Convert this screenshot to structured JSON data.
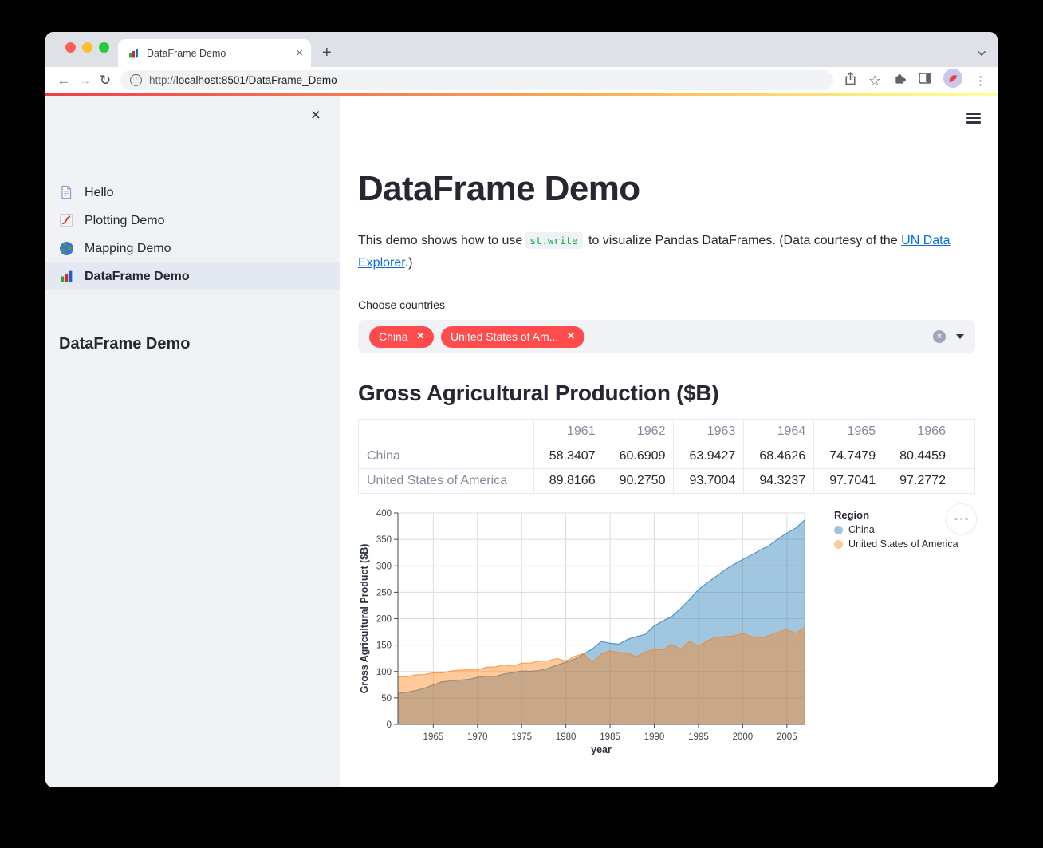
{
  "browser": {
    "tab_title": "DataFrame Demo",
    "url_scheme": "http://",
    "url_rest": "localhost:8501/DataFrame_Demo",
    "new_tab_label": "+"
  },
  "icons": {
    "back": "←",
    "forward": "→",
    "reload": "↻",
    "info": "i",
    "star": "☆",
    "dots_vertical": "⋮",
    "close": "×"
  },
  "sidebar": {
    "nav": [
      {
        "label": "Hello",
        "icon": "doc-icon",
        "selected": false
      },
      {
        "label": "Plotting Demo",
        "icon": "line-chart-icon",
        "selected": false
      },
      {
        "label": "Mapping Demo",
        "icon": "globe-icon",
        "selected": false
      },
      {
        "label": "DataFrame Demo",
        "icon": "bar-chart-icon",
        "selected": true
      }
    ],
    "title": "DataFrame Demo"
  },
  "main": {
    "title": "DataFrame Demo",
    "intro": {
      "before_code": "This demo shows how to use",
      "code": "st.write",
      "after_code": " to visualize Pandas DataFrames. (Data courtesy of the ",
      "link": "UN Data Explorer",
      "after_link": ".)"
    },
    "multiselect": {
      "label": "Choose countries",
      "selected": [
        "China",
        "United States of Am..."
      ]
    },
    "section_title": "Gross Agricultural Production ($B)",
    "table": {
      "headers": [
        "",
        "1961",
        "1962",
        "1963",
        "1964",
        "1965",
        "1966"
      ],
      "rows": [
        {
          "label": "China",
          "values": [
            "58.3407",
            "60.6909",
            "63.9427",
            "68.4626",
            "74.7479",
            "80.4459"
          ]
        },
        {
          "label": "United States of America",
          "values": [
            "89.8166",
            "90.2750",
            "93.7004",
            "94.3237",
            "97.7041",
            "97.2772"
          ]
        }
      ]
    }
  },
  "chart_data": {
    "type": "area",
    "title": "",
    "xlabel": "year",
    "ylabel": "Gross Agricultural Product ($B)",
    "legend_title": "Region",
    "legend_position": "right",
    "grid": true,
    "x_range": [
      1961,
      2007
    ],
    "ylim": [
      0,
      400
    ],
    "x_ticks": [
      1965,
      1970,
      1975,
      1980,
      1985,
      1990,
      1995,
      2000,
      2005
    ],
    "y_ticks": [
      0,
      50,
      100,
      150,
      200,
      250,
      300,
      350,
      400
    ],
    "x": [
      1961,
      1962,
      1963,
      1964,
      1965,
      1966,
      1967,
      1968,
      1969,
      1970,
      1971,
      1972,
      1973,
      1974,
      1975,
      1976,
      1977,
      1978,
      1979,
      1980,
      1981,
      1982,
      1983,
      1984,
      1985,
      1986,
      1987,
      1988,
      1989,
      1990,
      1991,
      1992,
      1993,
      1994,
      1995,
      1996,
      1997,
      1998,
      1999,
      2000,
      2001,
      2002,
      2003,
      2004,
      2005,
      2006,
      2007
    ],
    "series": [
      {
        "name": "China",
        "fill": "rgba(31,119,180,0.42)",
        "stroke": "rgba(31,119,180,0.75)",
        "legend_swatch": "#a1c6e0",
        "values": [
          58.34,
          60.69,
          63.94,
          68.46,
          74.75,
          80.45,
          82.3,
          83.8,
          85.2,
          88.9,
          91.5,
          90.8,
          95.3,
          98.0,
          101.2,
          100.6,
          101.9,
          106.3,
          112.0,
          117.9,
          123.6,
          132.9,
          142.8,
          157.0,
          153.5,
          151.8,
          161.0,
          166.2,
          170.5,
          186.4,
          195.9,
          204.6,
          219.7,
          236.5,
          255.4,
          267.9,
          280.2,
          292.5,
          302.7,
          312.0,
          320.4,
          329.9,
          338.6,
          350.8,
          362.0,
          371.3,
          386.5
        ]
      },
      {
        "name": "United States of America",
        "fill": "rgba(255,127,14,0.42)",
        "stroke": "rgba(255,127,14,0.7)",
        "legend_swatch": "#ffc99a",
        "values": [
          89.82,
          90.28,
          93.7,
          94.32,
          97.7,
          97.28,
          101.2,
          102.5,
          103.1,
          102.9,
          108.3,
          108.9,
          112.4,
          110.2,
          115.8,
          116.3,
          119.7,
          120.1,
          124.5,
          119.8,
          128.9,
          133.8,
          117.2,
          133.0,
          138.9,
          136.1,
          134.2,
          128.0,
          137.3,
          142.1,
          141.0,
          151.2,
          142.3,
          157.4,
          148.2,
          158.3,
          164.8,
          166.4,
          167.2,
          172.3,
          166.2,
          163.4,
          168.0,
          174.3,
          178.9,
          172.4,
          182.9
        ]
      }
    ]
  },
  "colors": {
    "accent_red": "#ff4b4b",
    "link_blue": "#0b6ddb",
    "code_green": "#09ab3b",
    "text_dark": "#262730",
    "sidebar_bg": "#f0f2f6",
    "china_area": "#a1c6e0",
    "usa_area": "#ffc99a"
  }
}
